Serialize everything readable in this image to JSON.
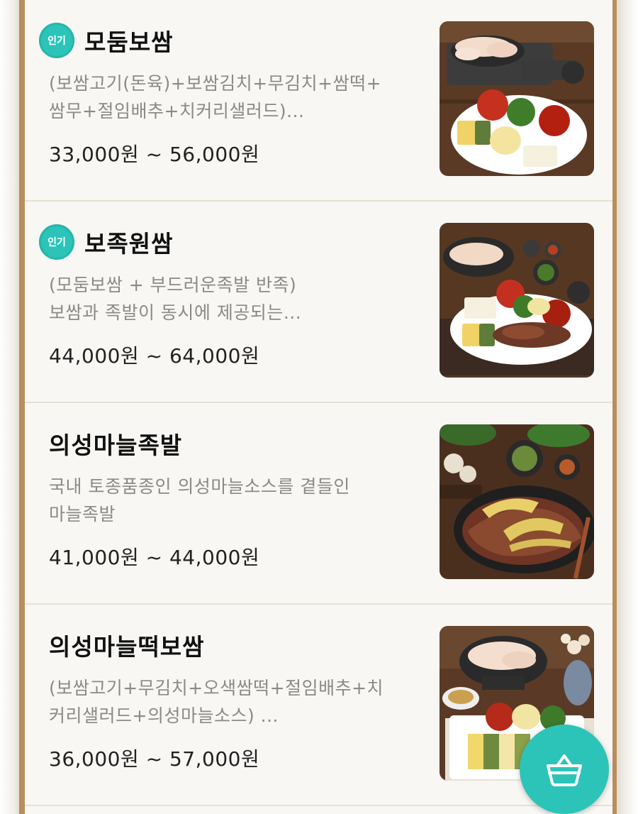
{
  "menu": {
    "items": [
      {
        "badge": "인기",
        "name": "모둠보쌈",
        "desc_line1": "(보쌈고기(돈육)+보쌈김치+무김치+쌈떡+",
        "desc_line2": "쌈무+절임배추+치커리샐러드)...",
        "price": "33,000원 ~ 56,000원"
      },
      {
        "badge": "인기",
        "name": "보족원쌈",
        "desc_line1": "(모둠보쌈 + 부드러운족발 반족)",
        "desc_line2": "보쌈과 족발이 동시에 제공되는...",
        "price": "44,000원 ~ 64,000원"
      },
      {
        "name": "의성마늘족발",
        "desc_line1": "국내 토종품종인 의성마늘소스를 곁들인",
        "desc_line2": "마늘족발",
        "price": "41,000원 ~ 44,000원"
      },
      {
        "name": "의성마늘떡보쌈",
        "desc_line1": "(보쌈고기+무김치+오색쌈떡+절임배추+치",
        "desc_line2": "커리샐러드+의성마늘소스) ...",
        "price": "36,000원 ~ 57,000원"
      }
    ]
  },
  "icons": {
    "cart": "shopping-basket-icon",
    "badge": "popular-badge"
  },
  "colors": {
    "accent": "#2cc4b8",
    "frame": "#b98d5e"
  }
}
